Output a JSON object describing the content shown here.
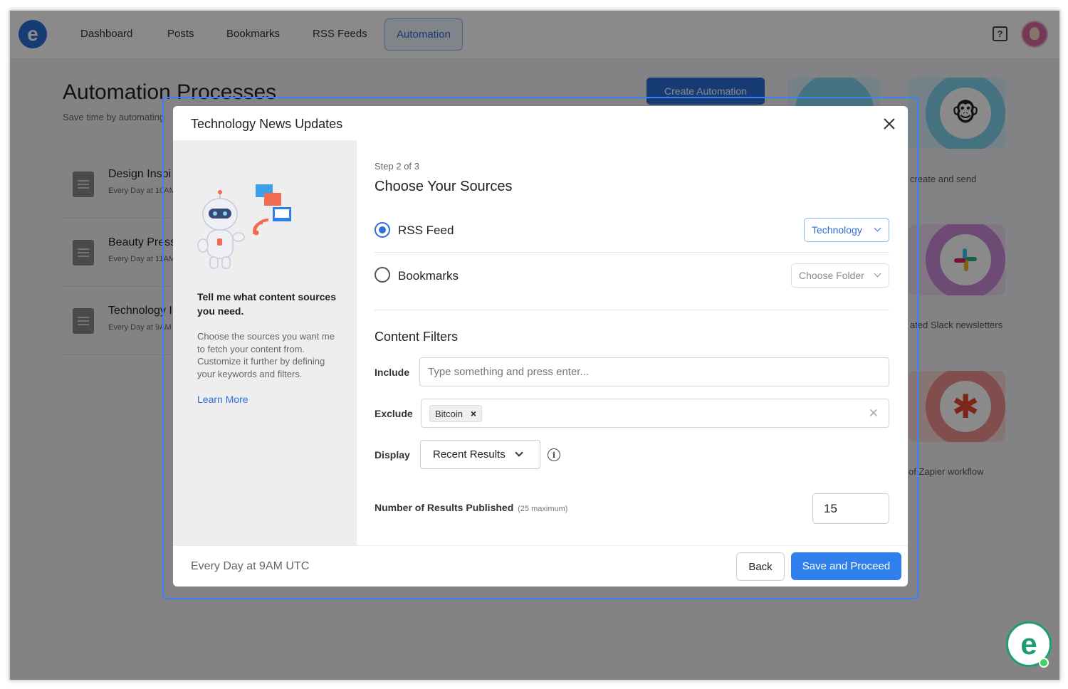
{
  "app": {
    "logo_letter": "e",
    "nav": [
      "Dashboard",
      "Posts",
      "Bookmarks",
      "RSS Feeds"
    ],
    "nav_active": "Automation",
    "help_glyph": "?"
  },
  "background": {
    "title": "Automation Processes",
    "subtitle": "Save time by automating",
    "create_button": "Create Automation",
    "processes": [
      {
        "name": "Design Inspi",
        "time": "Every Day at 10AM"
      },
      {
        "name": "Beauty Press",
        "time": "Every Day at 11AM"
      },
      {
        "name": "Technology I",
        "time": "Every Day at 9AM"
      }
    ],
    "tile_captions": [
      "create and send",
      "ated Slack newsletters",
      "of Zapier workflow"
    ],
    "tile_colors": [
      "#7fd3ee",
      "#c98bd6",
      "#f08e8e"
    ]
  },
  "modal": {
    "title": "Technology News Updates",
    "sidebar": {
      "heading": "Tell me what content sources you need.",
      "description": "Choose the sources you want me to fetch your content from. Customize it further by defining your keywords and filters.",
      "learn_more": "Learn More"
    },
    "step": "Step 2 of 3",
    "section_title": "Choose Your Sources",
    "sources": {
      "rss_label": "RSS Feed",
      "rss_selected": true,
      "rss_category": "Technology",
      "bookmarks_label": "Bookmarks",
      "folder_placeholder": "Choose Folder"
    },
    "filters": {
      "title": "Content Filters",
      "include_label": "Include",
      "include_placeholder": "Type something and press enter...",
      "include_value": "",
      "exclude_label": "Exclude",
      "exclude_tags": [
        "Bitcoin"
      ],
      "display_label": "Display",
      "display_value": "Recent Results",
      "info_glyph": "i"
    },
    "results": {
      "label": "Number of Results Published",
      "max_note": "(25 maximum)",
      "value": "15"
    },
    "footer": {
      "schedule": "Every Day at 9AM UTC",
      "back": "Back",
      "save": "Save and Proceed"
    }
  },
  "colors": {
    "accent": "#2c6fd8",
    "primary_button": "#2f7fec",
    "selection_outline": "#3b82f6",
    "chat_widget": "#1f9d6f"
  }
}
